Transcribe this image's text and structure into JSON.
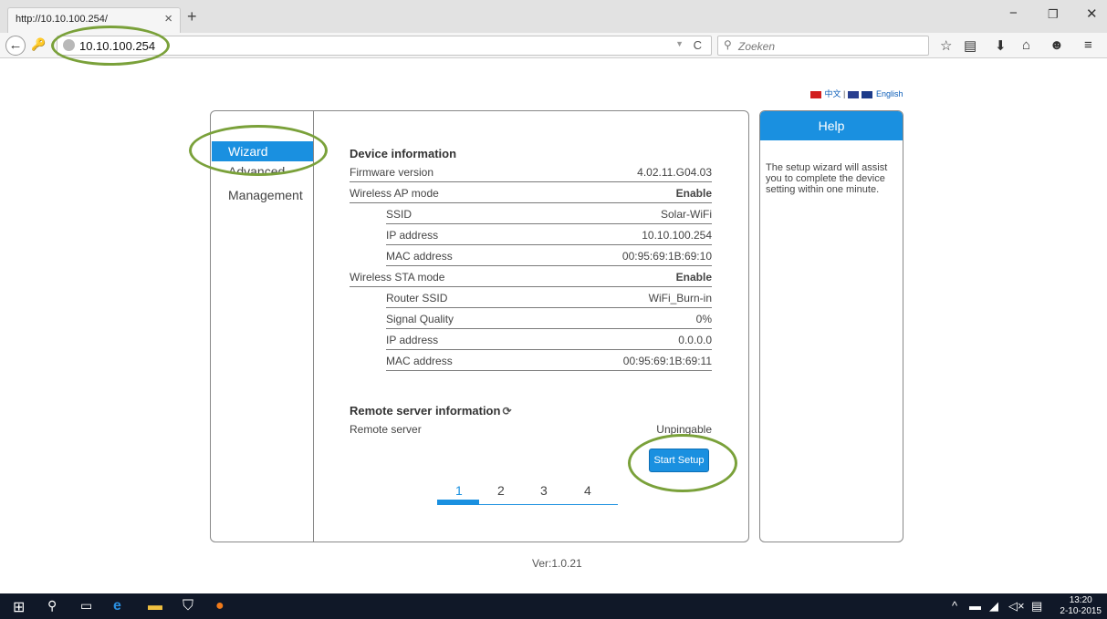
{
  "browser": {
    "tab_title": "http://10.10.100.254/",
    "tab_close": "×",
    "new_tab": "+",
    "window_controls": {
      "minimize": "−",
      "restore": "❐",
      "close": "✕"
    },
    "back": "←",
    "url": "10.10.100.254",
    "search_placeholder": "Zoeken",
    "toolbar_icons": [
      "star-icon",
      "reader-icon",
      "download-icon",
      "home-icon",
      "chat-icon",
      "menu-icon"
    ]
  },
  "lang": {
    "chinese": "中文",
    "separator": "|",
    "english": "English"
  },
  "sidebar": {
    "items": [
      {
        "label": "Wizard",
        "active": true
      },
      {
        "label": "Advanced",
        "active": false
      },
      {
        "label": "Management",
        "active": false
      }
    ]
  },
  "device_info": {
    "title": "Device information",
    "rows": [
      {
        "label": "Firmware version",
        "value": "4.02.11.G04.03",
        "bold": false
      },
      {
        "label": "Wireless AP mode",
        "value": "Enable",
        "bold": true
      },
      {
        "label": "SSID",
        "value": "Solar-WiFi",
        "bold": false
      },
      {
        "label": "IP address",
        "value": "10.10.100.254",
        "bold": false
      },
      {
        "label": "MAC address",
        "value": "00:95:69:1B:69:10",
        "bold": false
      },
      {
        "label": "Wireless STA mode",
        "value": "Enable",
        "bold": true
      },
      {
        "label": "Router SSID",
        "value": "WiFi_Burn-in",
        "bold": false
      },
      {
        "label": "Signal Quality",
        "value": "0%",
        "bold": false
      },
      {
        "label": "IP address",
        "value": "0.0.0.0",
        "bold": false
      },
      {
        "label": "MAC address",
        "value": "00:95:69:1B:69:11",
        "bold": false
      }
    ]
  },
  "remote": {
    "title": "Remote server information",
    "label": "Remote server",
    "value": "Unpingable"
  },
  "start_setup": "Start Setup",
  "steps": [
    "1",
    "2",
    "3",
    "4"
  ],
  "help": {
    "title": "Help",
    "text": "The setup wizard will assist you to complete the device setting within one minute."
  },
  "version": "Ver:1.0.21",
  "taskbar": {
    "time": "13:20",
    "date": "2-10-2015"
  },
  "colors": {
    "accent": "#1a90e0",
    "annotation": "#7aa13a"
  }
}
